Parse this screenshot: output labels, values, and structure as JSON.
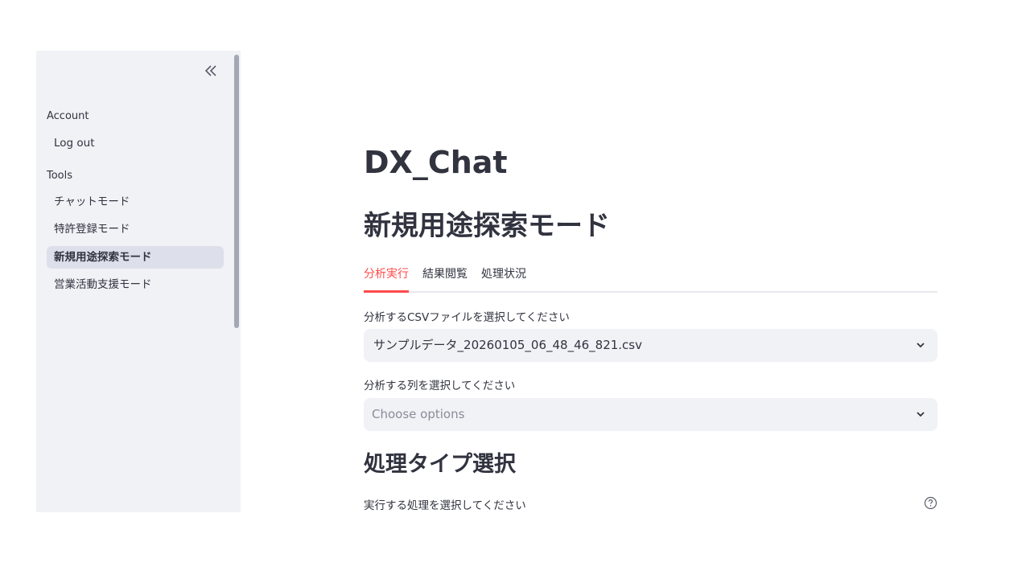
{
  "sidebar": {
    "collapse_icon": "double-chevron-left-icon",
    "account_label": "Account",
    "logout_label": "Log out",
    "tools_label": "Tools",
    "items": [
      {
        "label": "チャットモード",
        "active": false
      },
      {
        "label": "特許登録モード",
        "active": false
      },
      {
        "label": "新規用途探索モード",
        "active": true
      },
      {
        "label": "営業活動支援モード",
        "active": false
      }
    ]
  },
  "main": {
    "title": "DX_Chat",
    "subtitle": "新規用途探索モード",
    "tabs": [
      {
        "label": "分析実行",
        "active": true
      },
      {
        "label": "結果閲覧",
        "active": false
      },
      {
        "label": "処理状況",
        "active": false
      }
    ],
    "csv_select": {
      "label": "分析するCSVファイルを選択してください",
      "value": "サンプルデータ_20260105_06_48_46_821.csv"
    },
    "column_select": {
      "label": "分析する列を選択してください",
      "placeholder": "Choose options"
    },
    "process_heading": "処理タイプ選択",
    "process_label": "実行する処理を選択してください",
    "help_icon": "question-circle-icon"
  },
  "colors": {
    "accent": "#ff4b4b",
    "sidebar_bg": "#f0f2f6",
    "active_item_bg": "#dde0ea",
    "text": "#31333f"
  }
}
